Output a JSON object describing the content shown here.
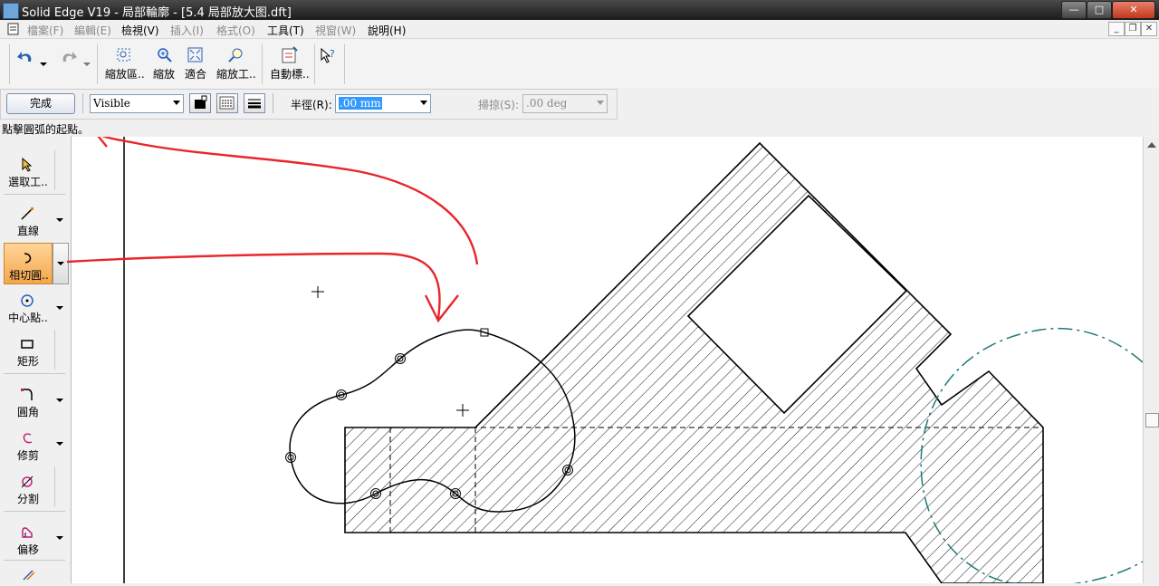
{
  "window": {
    "title": "Solid Edge V19 - 局部輪廓 - [5.4 局部放大图.dft]",
    "minimize": "—",
    "maximize": "□",
    "close": "✕"
  },
  "menu": {
    "file": "檔案(F)",
    "edit": "編輯(E)",
    "view": "檢視(V)",
    "insert": "插入(I)",
    "format": "格式(O)",
    "tools": "工具(T)",
    "window": "視窗(W)",
    "help": "說明(H)"
  },
  "mdi": {
    "minimize": "_",
    "restore": "❐",
    "close": "✕"
  },
  "toolbar": {
    "zoom_area": "縮放區..",
    "zoom": "縮放",
    "fit": "適合",
    "zoom_tool": "縮放工..",
    "auto_dim": "自動標.."
  },
  "ribbon": {
    "done": "完成",
    "linetype": "Visible",
    "radius_label": "半徑(R):",
    "radius_value": ".00 mm",
    "sweep_label": "掃掠(S):",
    "sweep_value": ".00 deg"
  },
  "prompt": "點擊圓弧的起點。",
  "tools": {
    "select": "選取工..",
    "line": "直線",
    "tangent_arc": "相切圓..",
    "center_point": "中心點..",
    "rectangle": "矩形",
    "fillet": "圓角",
    "trim": "修剪",
    "split": "分割",
    "offset": "偏移"
  },
  "colors": {
    "annotation_red": "#e8262b",
    "teal_circle": "#1f7a7a",
    "highlight": "#f5a64a"
  }
}
